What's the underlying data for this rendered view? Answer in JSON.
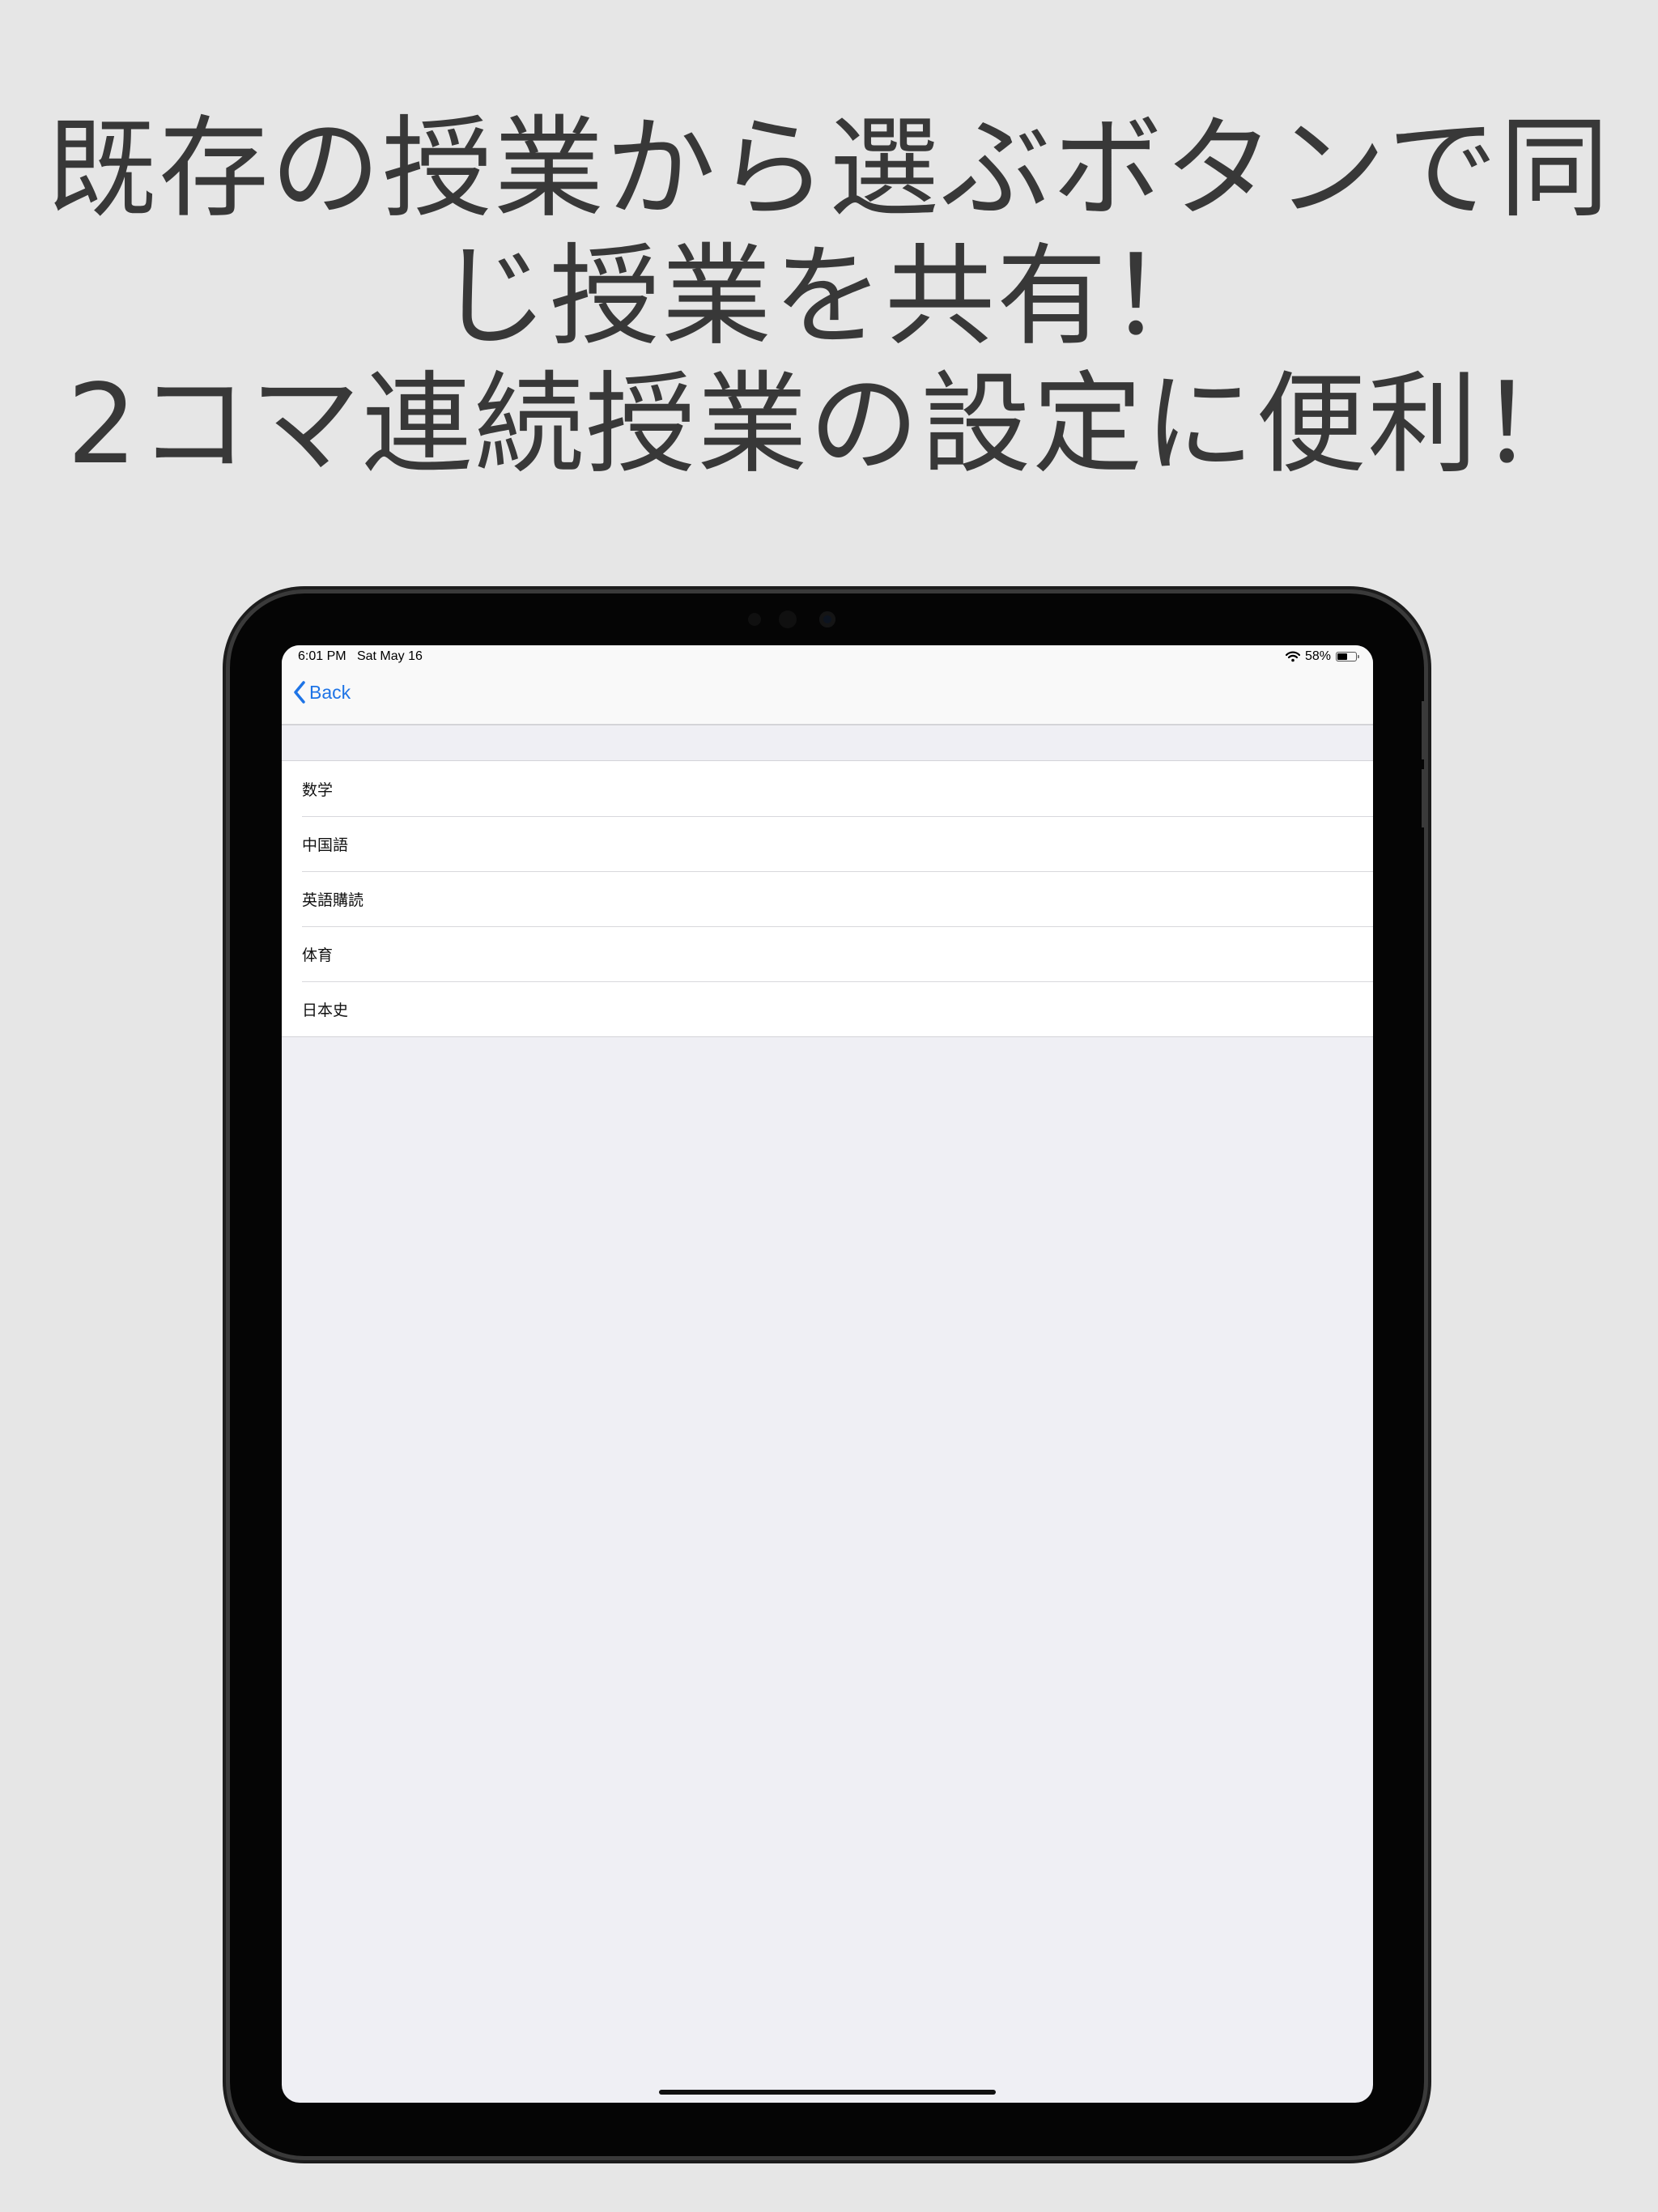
{
  "headline": {
    "line1": "既存の授業から選ぶボタンで同",
    "line2": "じ授業を共有！",
    "line3": "2コマ連続授業の設定に便利！"
  },
  "status_bar": {
    "time": "6:01 PM",
    "date": "Sat May 16",
    "battery": "58%",
    "battery_level": 0.58,
    "wifi_icon": "wifi-icon"
  },
  "navbar": {
    "back_label": "Back",
    "back_icon": "chevron-left-icon"
  },
  "colors": {
    "accent": "#1e74e6",
    "background": "#e6e6e6",
    "screen_background": "#efeff4",
    "headline_text": "#383838"
  },
  "subjects": [
    {
      "name": "数学"
    },
    {
      "name": "中国語"
    },
    {
      "name": "英語購読"
    },
    {
      "name": "体育"
    },
    {
      "name": "日本史"
    }
  ]
}
